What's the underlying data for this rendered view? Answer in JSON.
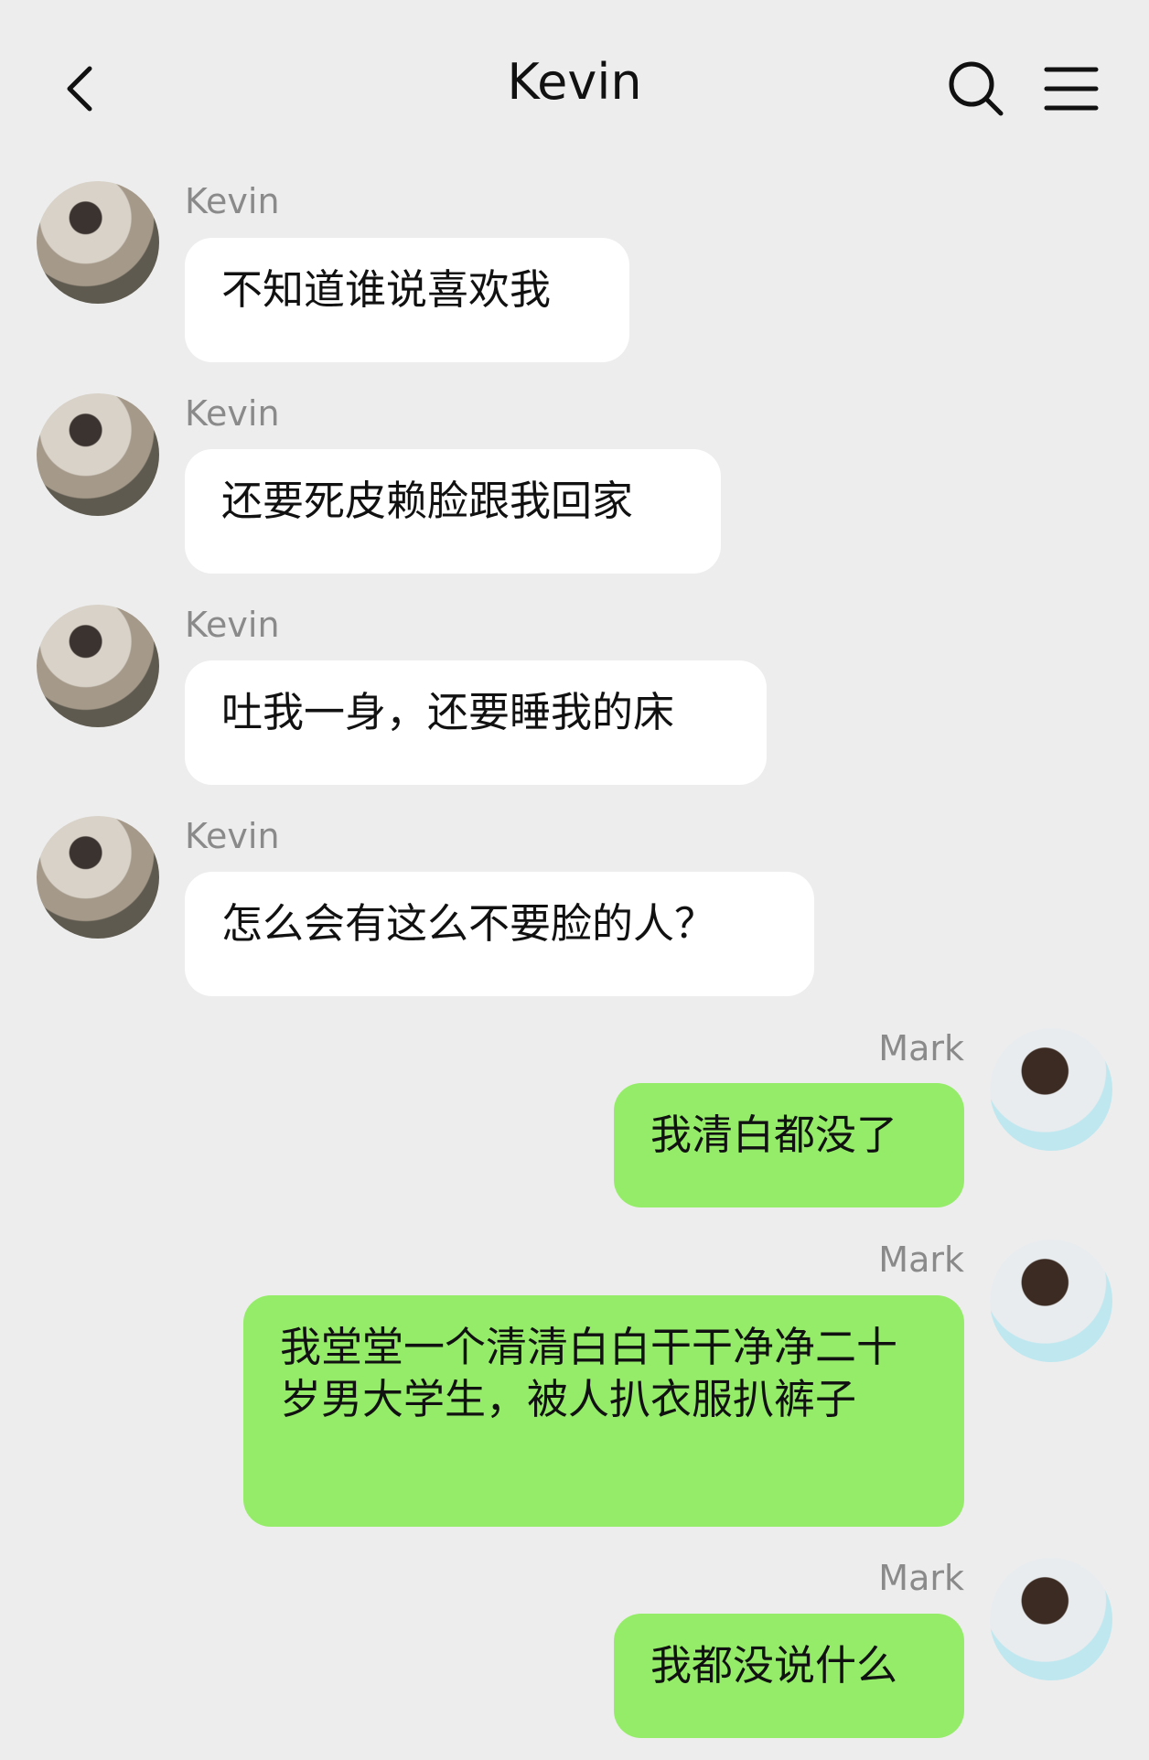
{
  "header": {
    "title": "Kevin",
    "back_icon": "chevron-left-icon",
    "search_icon": "search-icon",
    "menu_icon": "menu-icon"
  },
  "colors": {
    "background": "#ededed",
    "incoming_bubble": "#ffffff",
    "outgoing_bubble": "#95ec69"
  },
  "messages": [
    {
      "sender": "Kevin",
      "side": "left",
      "text": "不知道谁说喜欢我"
    },
    {
      "sender": "Kevin",
      "side": "left",
      "text": "还要死皮赖脸跟我回家"
    },
    {
      "sender": "Kevin",
      "side": "left",
      "text": "吐我一身，还要睡我的床"
    },
    {
      "sender": "Kevin",
      "side": "left",
      "text": "怎么会有这么不要脸的人？"
    },
    {
      "sender": "Mark",
      "side": "right",
      "text": "我清白都没了"
    },
    {
      "sender": "Mark",
      "side": "right",
      "text": "我堂堂一个清清白白干干净净二十岁男大学生，被人扒衣服扒裤子"
    },
    {
      "sender": "Mark",
      "side": "right",
      "text": "我都没说什么"
    }
  ]
}
